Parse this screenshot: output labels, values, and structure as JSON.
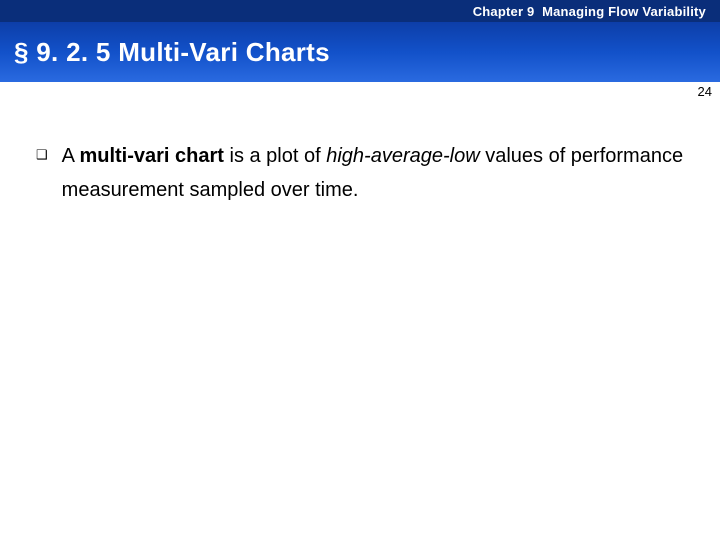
{
  "header": {
    "chapter_label": "Chapter 9",
    "chapter_title": "Managing Flow Variability"
  },
  "title": {
    "section_marker": "§ 9. 2. 5",
    "section_title": "Multi-Vari Charts"
  },
  "page_number": "24",
  "body": {
    "bullet_marker": "❑",
    "bullet_parts": {
      "t1": "A ",
      "strong": "multi-vari chart",
      "t2": " is a plot of ",
      "em": "high-average-low",
      "t3": " values of performance measurement sampled over time."
    }
  }
}
